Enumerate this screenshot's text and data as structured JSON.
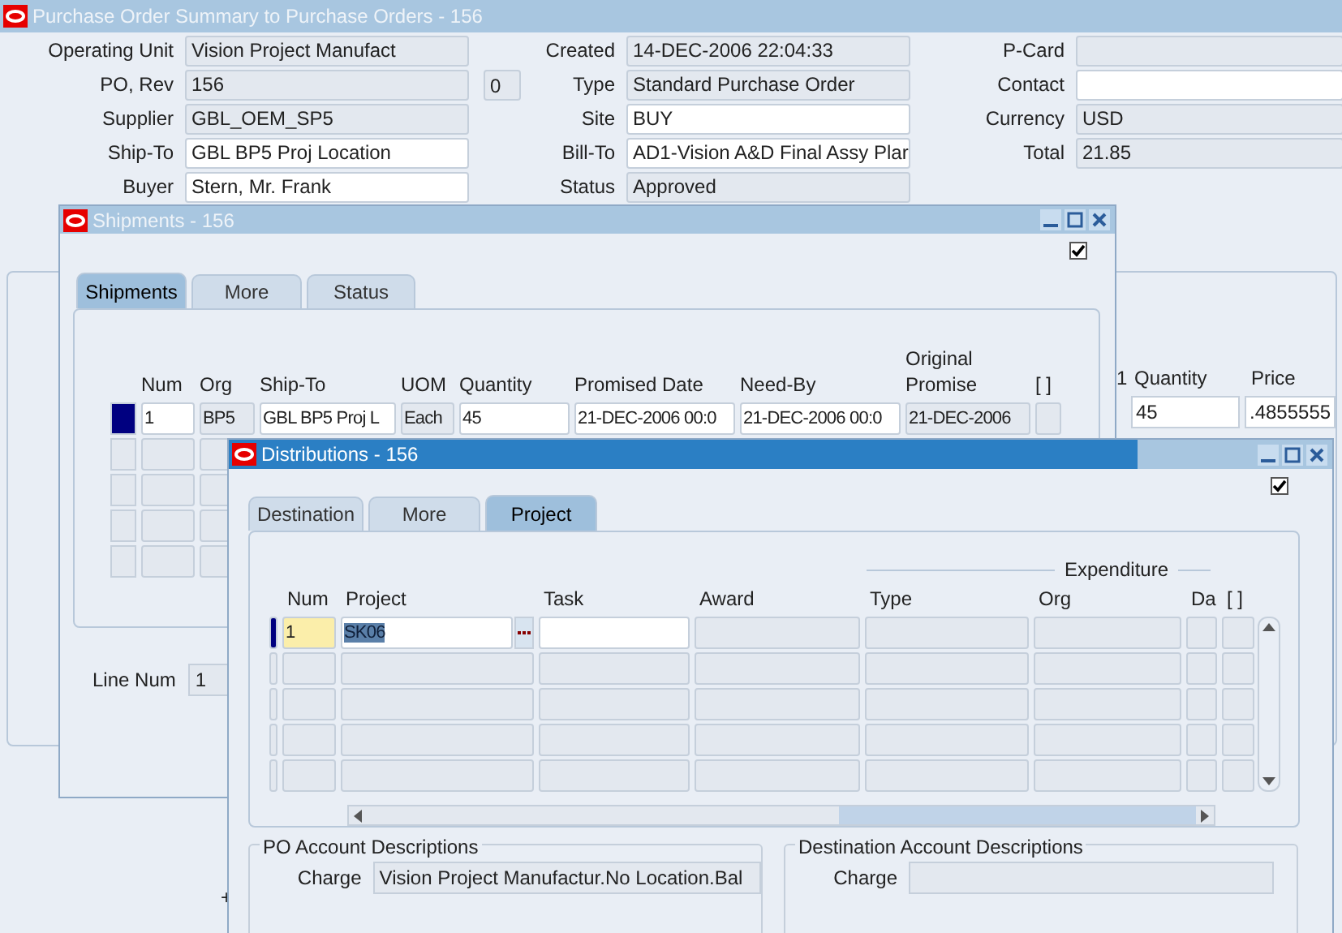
{
  "main_window": {
    "title": "Purchase Order Summary to Purchase Orders - 156",
    "active": false,
    "header_columns": [
      [
        {
          "label": "Operating Unit",
          "value": "Vision Project Manufact",
          "editable": false
        },
        {
          "label": "PO, Rev",
          "value": "156",
          "revision": "0",
          "editable": false
        },
        {
          "label": "Supplier",
          "value": "GBL_OEM_SP5",
          "editable": false
        },
        {
          "label": "Ship-To",
          "value": "GBL BP5 Proj Location",
          "editable": true
        },
        {
          "label": "Buyer",
          "value": "Stern, Mr. Frank",
          "editable": true
        }
      ],
      [
        {
          "label": "Created",
          "value": "14-DEC-2006 22:04:33",
          "editable": false
        },
        {
          "label": "Type",
          "value": "Standard Purchase Order",
          "editable": false
        },
        {
          "label": "Site",
          "value": "BUY",
          "editable": true
        },
        {
          "label": "Bill-To",
          "value": "AD1-Vision A&D Final Assy Plar",
          "editable": true
        },
        {
          "label": "Status",
          "value": "Approved",
          "editable": false
        }
      ],
      [
        {
          "label": "P-Card",
          "editable": false
        },
        {
          "label": "Contact",
          "editable": true
        },
        {
          "label": "Currency",
          "value": "USD",
          "editable": false
        },
        {
          "label": "Total",
          "value": "21.85",
          "editable": false
        }
      ]
    ],
    "lines": {
      "columns": [
        "1",
        "Quantity",
        "Price"
      ],
      "values": [
        "45",
        ".4855555"
      ]
    },
    "expand_glyph": "+"
  },
  "shipments_window": {
    "title": "Shipments - 156",
    "active": false,
    "checked": true,
    "tabs": [
      {
        "label": "Shipments",
        "selected": true
      },
      {
        "label": "More",
        "selected": false
      },
      {
        "label": "Status",
        "selected": false
      }
    ],
    "columns": [
      "Num",
      "Org",
      "Ship-To",
      "UOM",
      "Quantity",
      "Promised Date",
      "Need-By",
      "Original Promise",
      "[ ]"
    ],
    "rows": [
      {
        "current": true,
        "cells": [
          {
            "value": "1",
            "kind": "input"
          },
          {
            "value": "BP5",
            "kind": "display"
          },
          {
            "value": "GBL BP5 Proj L",
            "kind": "input"
          },
          {
            "value": "Each",
            "kind": "display"
          },
          {
            "value": "45",
            "kind": "input"
          },
          {
            "value": "21-DEC-2006 00:0",
            "kind": "input"
          },
          {
            "value": "21-DEC-2006 00:0",
            "kind": "input"
          },
          {
            "value": "21-DEC-2006",
            "kind": "display"
          },
          {
            "kind": "display"
          }
        ]
      },
      {
        "current": false
      },
      {
        "current": false
      },
      {
        "current": false
      },
      {
        "current": false
      }
    ],
    "line_num_label": "Line Num",
    "line_num": "1"
  },
  "distributions_window": {
    "title": "Distributions - 156",
    "active": true,
    "checked": true,
    "tabs": [
      {
        "label": "Destination",
        "selected": false
      },
      {
        "label": "More",
        "selected": false
      },
      {
        "label": "Project",
        "selected": true
      }
    ],
    "group_header": "Expenditure",
    "columns": [
      "Num",
      "Project",
      "Task",
      "Award",
      "Type",
      "Org",
      "Da",
      "[ ]"
    ],
    "rows": [
      {
        "current": true,
        "cells": [
          {
            "value": "1",
            "kind": "marker"
          },
          {
            "value": "SK06",
            "kind": "input",
            "selected": true,
            "lov": true
          },
          {
            "kind": "input"
          },
          {
            "kind": "display"
          },
          {
            "kind": "display"
          },
          {
            "kind": "display"
          },
          {
            "kind": "display"
          },
          {
            "kind": "display"
          }
        ]
      },
      {
        "current": false
      },
      {
        "current": false
      },
      {
        "current": false
      },
      {
        "current": false
      }
    ],
    "account_groups": [
      {
        "title": "PO Account Descriptions",
        "fields": [
          {
            "label": "Charge",
            "value": "Vision Project Manufactur.No Location.Bal"
          }
        ]
      },
      {
        "title": "Destination Account Descriptions",
        "fields": [
          {
            "label": "Charge"
          }
        ]
      }
    ]
  }
}
